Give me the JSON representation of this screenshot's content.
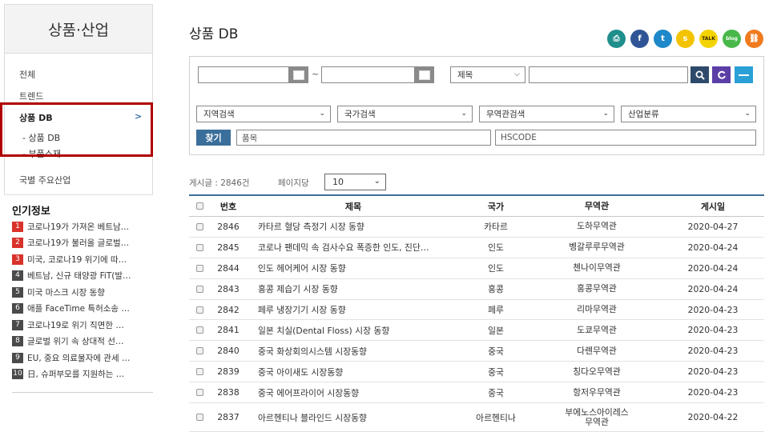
{
  "sidebar": {
    "header": "상품·산업",
    "items": [
      {
        "label": "전체"
      },
      {
        "label": "트렌드"
      },
      {
        "label": "상품 DB",
        "active": true,
        "arrow": ">"
      },
      {
        "label": "국별 주요산업"
      }
    ],
    "sub_items": [
      {
        "label": "상품 DB"
      },
      {
        "label": "부품소재"
      }
    ],
    "highlight_color": "#b00000"
  },
  "popular": {
    "title": "인기정보",
    "items": [
      {
        "num": "1",
        "text": "코로나19가 가져온 베트남…",
        "color": "#d9322b"
      },
      {
        "num": "2",
        "text": "코로나19가 불러올 글로벌…",
        "color": "#d9322b"
      },
      {
        "num": "3",
        "text": "미국, 코로나19 위기에 따…",
        "color": "#d9322b"
      },
      {
        "num": "4",
        "text": "베트남, 신규 태양광 FiT(발…",
        "color": "#4a4a4a"
      },
      {
        "num": "5",
        "text": "미국 마스크 시장 동향",
        "color": "#4a4a4a"
      },
      {
        "num": "6",
        "text": "애플 FaceTime 특허소송 …",
        "color": "#4a4a4a"
      },
      {
        "num": "7",
        "text": "코로나19로 위기 직면한 …",
        "color": "#4a4a4a"
      },
      {
        "num": "8",
        "text": "글로벌 위기 속 상대적 선…",
        "color": "#4a4a4a"
      },
      {
        "num": "9",
        "text": "EU, 중요 의료물자에 관세 …",
        "color": "#4a4a4a"
      },
      {
        "num": "10",
        "text": "日, 슈퍼부모를 지원하는 …",
        "color": "#4a4a4a"
      }
    ]
  },
  "main": {
    "title": "상품 DB",
    "share_icons": [
      {
        "name": "print-icon",
        "glyph": "⎙",
        "color": "#1f8f8c"
      },
      {
        "name": "facebook-icon",
        "glyph": "f",
        "color": "#2f5597"
      },
      {
        "name": "twitter-icon",
        "glyph": "t",
        "color": "#1e88c8"
      },
      {
        "name": "kakaostory-icon",
        "glyph": "s",
        "color": "#f3c300"
      },
      {
        "name": "kakaotalk-icon",
        "glyph": "TALK",
        "color": "#f3d300"
      },
      {
        "name": "blog-icon",
        "glyph": "blog",
        "color": "#48b84a"
      },
      {
        "name": "link-icon",
        "glyph": "⛓",
        "color": "#f07b1f"
      }
    ]
  },
  "search": {
    "date_separator": "~",
    "field_select": "제목",
    "filters": [
      "지역검색",
      "국가검색",
      "무역관검색",
      "산업분류"
    ],
    "find_button": "찾기",
    "item_placeholder": "품목",
    "hscode_placeholder": "HSCODE",
    "colors": {
      "search": "#2d4a6b",
      "reset": "#5b3fa6",
      "toggle": "#2aa0d6"
    }
  },
  "list": {
    "count_text": "게시글 : 2846건",
    "per_page_label": "페이지당",
    "per_page_value": "10",
    "columns": {
      "no": "번호",
      "title": "제목",
      "country": "국가",
      "office": "무역관",
      "date": "게시일"
    },
    "rows": [
      {
        "no": "2846",
        "title": "카타르 혈당 측정기 시장 동향",
        "country": "카타르",
        "office": "도하무역관",
        "date": "2020-04-27"
      },
      {
        "no": "2845",
        "title": "코로나 팬데믹 속 검사수요 폭증한 인도, 진단…",
        "country": "인도",
        "office": "벵갈루루무역관",
        "date": "2020-04-24"
      },
      {
        "no": "2844",
        "title": "인도 헤어케어 시장 동향",
        "country": "인도",
        "office": "첸나이무역관",
        "date": "2020-04-24"
      },
      {
        "no": "2843",
        "title": "홍콩 제습기 시장 동향",
        "country": "홍콩",
        "office": "홍콩무역관",
        "date": "2020-04-24"
      },
      {
        "no": "2842",
        "title": "페루 냉장기기 시장 동향",
        "country": "페루",
        "office": "리마무역관",
        "date": "2020-04-23"
      },
      {
        "no": "2841",
        "title": "일본 치실(Dental Floss) 시장 동향",
        "country": "일본",
        "office": "도쿄무역관",
        "date": "2020-04-23"
      },
      {
        "no": "2840",
        "title": "중국 화상회의시스템 시장동향",
        "country": "중국",
        "office": "다롄무역관",
        "date": "2020-04-23"
      },
      {
        "no": "2839",
        "title": "중국 아이새도 시장동향",
        "country": "중국",
        "office": "칭다오무역관",
        "date": "2020-04-23"
      },
      {
        "no": "2838",
        "title": "중국 에어프라이어 시장동향",
        "country": "중국",
        "office": "항저우무역관",
        "date": "2020-04-23"
      },
      {
        "no": "2837",
        "title": "아르헨티나 블라인드 시장동향",
        "country": "아르헨티나",
        "office": "부에노스아이레스무역관",
        "date": "2020-04-22"
      }
    ]
  }
}
